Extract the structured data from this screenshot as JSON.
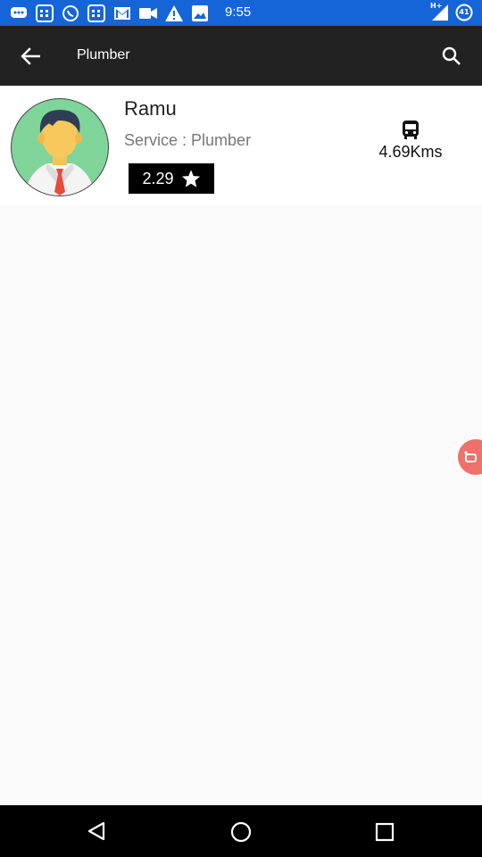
{
  "status_bar": {
    "time": "9:55",
    "battery_level": "41",
    "notification_icons": [
      "messages-icon",
      "calendar-icon",
      "whatsapp-icon",
      "calendar-icon",
      "gmail-icon",
      "video-icon",
      "warning-icon",
      "image-icon"
    ],
    "network_label": "H+"
  },
  "toolbar": {
    "title": "Plumber"
  },
  "provider": {
    "name": "Ramu",
    "service_label": "Service :",
    "service_value": "Plumber",
    "rating": "2.29",
    "distance": "4.69Kms"
  },
  "colors": {
    "status_bar": "#1565d8",
    "toolbar": "#222222",
    "avatar_bg": "#7fd49a",
    "bubble": "#f0706a"
  }
}
